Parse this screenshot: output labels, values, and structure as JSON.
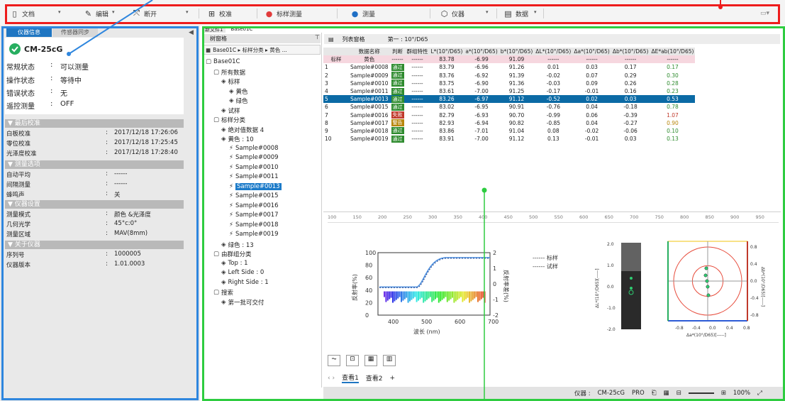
{
  "toolbar": {
    "items": [
      {
        "label": "文档",
        "icon": "document-icon"
      },
      {
        "label": "编辑",
        "icon": "pencil-icon"
      },
      {
        "label": "断开",
        "icon": "disconnect-icon"
      },
      {
        "label": "校准",
        "icon": "calibrate-icon"
      },
      {
        "label": "标样测量",
        "icon": "measure-standard-icon"
      },
      {
        "label": "测量",
        "icon": "measure-icon"
      },
      {
        "label": "仪器",
        "icon": "instrument-icon"
      },
      {
        "label": "数据",
        "icon": "data-icon"
      }
    ]
  },
  "left_panel": {
    "tabs": [
      "仪器信息",
      "传感器同步"
    ],
    "device_name": "CM-25cG",
    "status": [
      {
        "key": "常规状态",
        "value": "可以测量"
      },
      {
        "key": "操作状态",
        "value": "等待中"
      },
      {
        "key": "错误状态",
        "value": "无"
      },
      {
        "key": "遥控测量",
        "value": "OFF"
      }
    ],
    "sections": [
      {
        "title": "▼ 最后校准",
        "rows": [
          {
            "k": "白板校准",
            "v": "2017/12/18 17:26:06"
          },
          {
            "k": "零位校准",
            "v": "2017/12/18 17:25:45"
          },
          {
            "k": "光泽度校准",
            "v": "2017/12/18 17:28:40"
          }
        ]
      },
      {
        "title": "▼ 测量选项",
        "rows": [
          {
            "k": "自动平均",
            "v": "------"
          },
          {
            "k": "间隔测量",
            "v": "------"
          },
          {
            "k": "蜂鸣声",
            "v": "关"
          }
        ]
      },
      {
        "title": "▼ 仪器设置",
        "rows": [
          {
            "k": "测量模式",
            "v": "颜色 &光泽度"
          },
          {
            "k": "几何光学",
            "v": "45°c:0°"
          },
          {
            "k": "测量区域",
            "v": "MAV(8mm)"
          }
        ]
      },
      {
        "title": "▼ 关于仪器",
        "rows": [
          {
            "k": "序列号",
            "v": "1000005"
          },
          {
            "k": "仪器版本",
            "v": "1.01.0003"
          }
        ]
      }
    ]
  },
  "doc_tabs": [
    "新文件1",
    "Base01C"
  ],
  "tree": {
    "header": "树窗格",
    "breadcrumb": "Base01C ▸ 标样分类 ▸ 黄色 ...",
    "nodes": [
      {
        "label": "Base01C",
        "indent": 0
      },
      {
        "label": "所有数据",
        "indent": 1
      },
      {
        "label": "标样",
        "indent": 2
      },
      {
        "label": "黄色",
        "indent": 3
      },
      {
        "label": "绿色",
        "indent": 3
      },
      {
        "label": "试样",
        "indent": 2
      },
      {
        "label": "标样分类",
        "indent": 1
      },
      {
        "label": "绝对值数据 4",
        "indent": 2
      },
      {
        "label": "黄色 : 10",
        "indent": 2
      },
      {
        "label": "Sample#0008",
        "indent": 3
      },
      {
        "label": "Sample#0009",
        "indent": 3
      },
      {
        "label": "Sample#0010",
        "indent": 3
      },
      {
        "label": "Sample#0011",
        "indent": 3
      },
      {
        "label": "Sample#0013",
        "indent": 3,
        "selected": true
      },
      {
        "label": "Sample#0015",
        "indent": 3
      },
      {
        "label": "Sample#0016",
        "indent": 3
      },
      {
        "label": "Sample#0017",
        "indent": 3
      },
      {
        "label": "Sample#0018",
        "indent": 3
      },
      {
        "label": "Sample#0019",
        "indent": 3
      },
      {
        "label": "绿色 : 13",
        "indent": 2
      },
      {
        "label": "由群组分类",
        "indent": 1
      },
      {
        "label": "Top : 1",
        "indent": 2
      },
      {
        "label": "Left Side : 0",
        "indent": 2
      },
      {
        "label": "Right Side : 1",
        "indent": 2
      },
      {
        "label": "搜索",
        "indent": 1
      },
      {
        "label": "第一批可交付",
        "indent": 2
      }
    ]
  },
  "table": {
    "header": "列表窗格",
    "observer": "第一 : 10°/D65",
    "columns": [
      "",
      "数据名称",
      "判断",
      "群组特性",
      "L*(10°/D65)",
      "a*(10°/D65)",
      "b*(10°/D65)",
      "ΔL*(10°/D65)",
      "Δa*(10°/D65)",
      "Δb*(10°/D65)",
      "ΔE*ab(10°/D65)"
    ],
    "standard": [
      "标样",
      "黄色",
      "------",
      "------",
      "83.78",
      "-6.99",
      "91.09",
      "------",
      "------",
      "------",
      "------"
    ],
    "rows": [
      [
        "1",
        "Sample#0008",
        "通过",
        "------",
        "83.79",
        "-6.96",
        "91.26",
        "0.01",
        "0.03",
        "0.17",
        "0.17"
      ],
      [
        "2",
        "Sample#0009",
        "通过",
        "------",
        "83.76",
        "-6.92",
        "91.39",
        "-0.02",
        "0.07",
        "0.29",
        "0.30"
      ],
      [
        "3",
        "Sample#0010",
        "通过",
        "------",
        "83.75",
        "-6.90",
        "91.36",
        "-0.03",
        "0.09",
        "0.26",
        "0.28"
      ],
      [
        "4",
        "Sample#0011",
        "通过",
        "------",
        "83.61",
        "-7.00",
        "91.25",
        "-0.17",
        "-0.01",
        "0.16",
        "0.23"
      ],
      [
        "5",
        "Sample#0013",
        "通过",
        "------",
        "83.26",
        "-6.97",
        "91.12",
        "-0.52",
        "0.02",
        "0.03",
        "0.53"
      ],
      [
        "6",
        "Sample#0015",
        "通过",
        "------",
        "83.02",
        "-6.95",
        "90.91",
        "-0.76",
        "0.04",
        "-0.18",
        "0.78"
      ],
      [
        "7",
        "Sample#0016",
        "失败",
        "------",
        "82.79",
        "-6.93",
        "90.70",
        "-0.99",
        "0.06",
        "-0.39",
        "1.07"
      ],
      [
        "8",
        "Sample#0017",
        "警告",
        "------",
        "82.93",
        "-6.94",
        "90.82",
        "-0.85",
        "0.04",
        "-0.27",
        "0.90"
      ],
      [
        "9",
        "Sample#0018",
        "通过",
        "------",
        "83.86",
        "-7.01",
        "91.04",
        "0.08",
        "-0.02",
        "-0.06",
        "0.10"
      ],
      [
        "10",
        "Sample#0019",
        "通过",
        "------",
        "83.91",
        "-7.00",
        "91.12",
        "0.13",
        "-0.01",
        "0.03",
        "0.13"
      ]
    ],
    "selected_index": 4,
    "judge_colors": {
      "通过": "#2e8b2e",
      "失败": "#c0392b",
      "警告": "#b8860b"
    }
  },
  "charts": {
    "ruler_ticks": [
      "100",
      "150",
      "200",
      "250",
      "300",
      "350",
      "400",
      "450",
      "500",
      "550",
      "600",
      "650",
      "700",
      "750",
      "800",
      "850",
      "900",
      "950"
    ],
    "spectral": {
      "ylabel": "反射率(%)",
      "ylabel_right": "反射率差(%)",
      "xlabel": "波长 (nm)",
      "yticks": [
        "100",
        "80",
        "60",
        "40",
        "20",
        "0"
      ],
      "yticks_right": [
        "2",
        "1",
        "0",
        "-1",
        "-2"
      ],
      "xticks": [
        "400",
        "500",
        "600",
        "700"
      ],
      "legend": [
        "------ 标样",
        "------ 试样"
      ]
    },
    "lab": {
      "ylabel": "ΔL*(10°/D65)[-----]",
      "ylabel_right": "Δb*(10°/D65)[-----]",
      "xlabel": "Δa*(10°/D65)[-----]",
      "l_ticks": [
        "2.0",
        "1.0",
        "0.0",
        "-1.0",
        "-2.0"
      ],
      "b_ticks": [
        "0.8",
        "0.4",
        "0.0",
        "-0.4",
        "-0.8"
      ],
      "a_ticks": [
        "-0.8",
        "-0.4",
        "0.0",
        "0.4",
        "0.8"
      ]
    }
  },
  "bottom_tabs": [
    "查看1",
    "查看2",
    "+"
  ],
  "statusbar": {
    "instrument_label": "仪器 :",
    "instrument_value": "CM-25cG",
    "pro": "PRO",
    "zoom": "100%"
  },
  "colors": {
    "toolbar_frame": "#ee1c1c",
    "left_frame": "#2e86de",
    "right_frame": "#2ecc40",
    "selection": "#0b6aa5"
  }
}
